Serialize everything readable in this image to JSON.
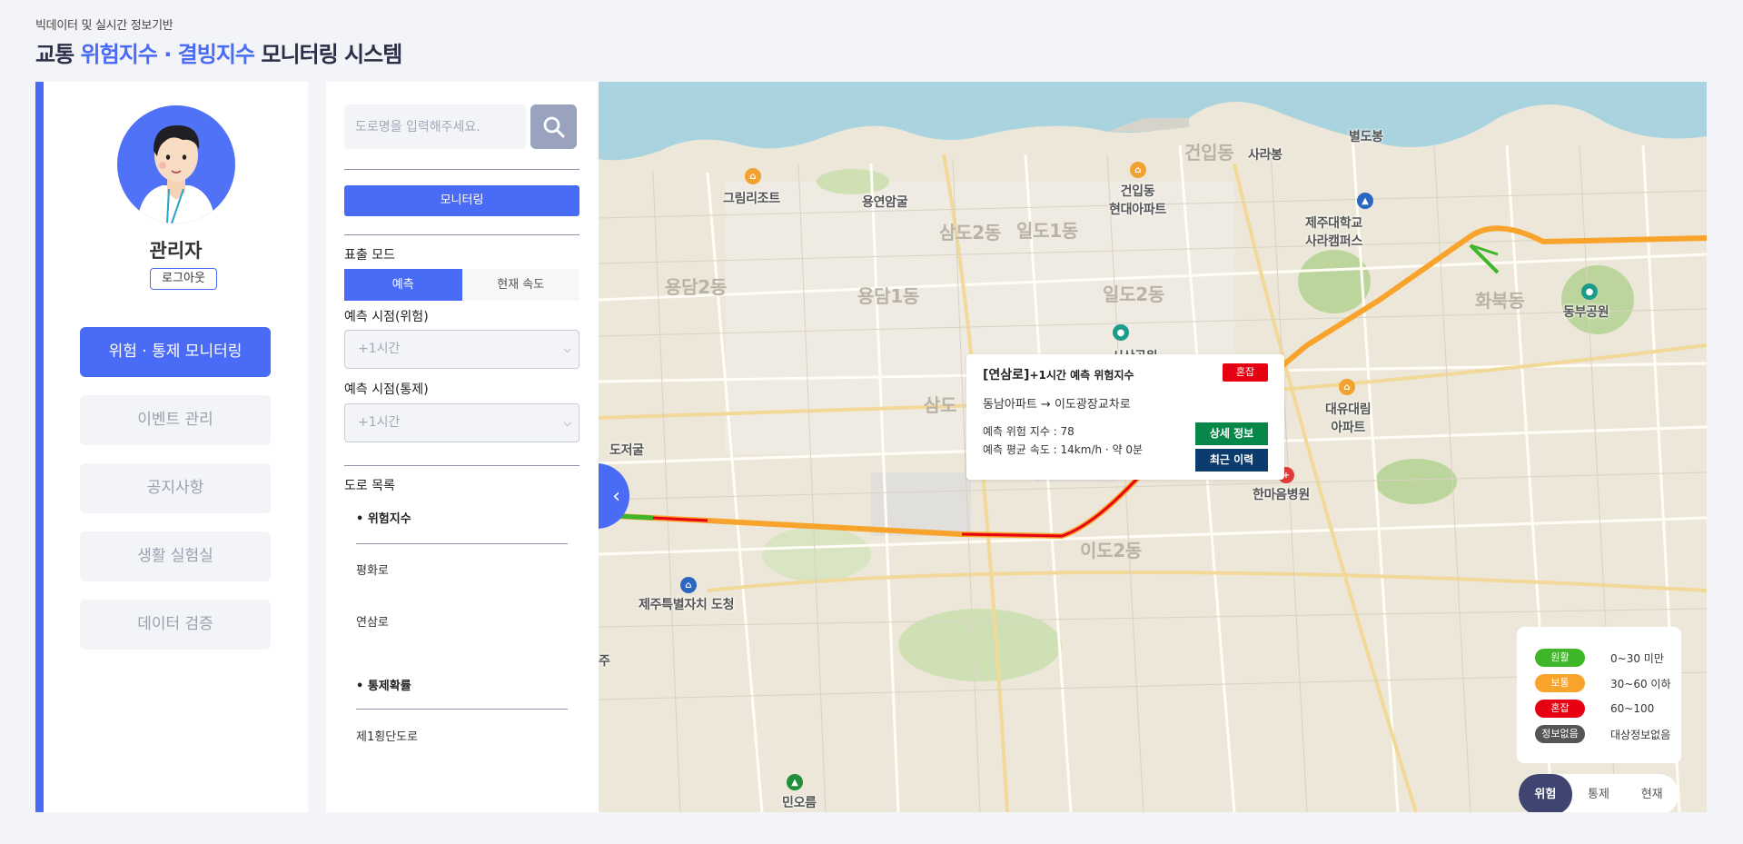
{
  "header": {
    "subtitle": "빅데이터 및 실시간 정보기반",
    "title_prefix": "교통",
    "title_highlight": "위험지수 · 결빙지수",
    "title_suffix": "모니터링 시스템"
  },
  "user": {
    "name": "관리자",
    "logout_label": "로그아웃"
  },
  "menu": {
    "items": [
      {
        "label": "위험 · 통제 모니터링",
        "active": true
      },
      {
        "label": "이벤트 관리",
        "active": false
      },
      {
        "label": "공지사항",
        "active": false
      },
      {
        "label": "생활 실험실",
        "active": false
      },
      {
        "label": "데이터 검증",
        "active": false
      }
    ]
  },
  "controls": {
    "search_placeholder": "도로명을 입력해주세요.",
    "monitor_label": "모니터링",
    "mode_label": "표출 모드",
    "mode_options": [
      "예측",
      "현재 속도"
    ],
    "forecast_risk_label": "예측 시점(위험)",
    "forecast_risk_value": "+1시간",
    "forecast_control_label": "예측 시점(통제)",
    "forecast_control_value": "+1시간",
    "road_list_label": "도로 목록",
    "risk_group_label": "• 위험지수",
    "risk_roads": [
      "평화로",
      "연삼로"
    ],
    "control_group_label": "• 통제확률",
    "control_roads": [
      "제1횡단도로"
    ]
  },
  "map": {
    "labels": {
      "grim_resort": "그림리조트",
      "yongyeon": "용연암굴",
      "geonip_apt": "건입동\n현대아파트",
      "geonip": "건입동",
      "sarabong": "사라봉",
      "byeoldobong": "별도봉",
      "jnu": "제주대학교\n사라캠퍼스",
      "hwabuk": "화북동",
      "dongbu_park": "동부공원",
      "yongdam2": "용담2동",
      "yongdam1": "용담1동",
      "samdo2": "삼도2동",
      "ildo1": "일도1동",
      "ildo2": "일도2동",
      "samdo": "삼도",
      "sisan": "시산공원",
      "daeyu_apt": "대유대림\n아파트",
      "dojeogul": "도저굴",
      "hanmaeul": "한마음병원",
      "ido2": "이도2동",
      "jeju_gov": "제주특별자치 도청",
      "minoreum": "민오름",
      "ju": "주"
    },
    "popup": {
      "road": "[연삼로]",
      "subtitle": "+1시간 예측 위험지수",
      "badge": "혼잡",
      "route": "동남아파트 → 이도광장교차로",
      "risk_line": "예측 위험 지수 : 78",
      "speed_line": "예측 평균 속도 : 14km/h · 약 0분",
      "detail_btn": "상세 정보",
      "history_btn": "최근 이력"
    },
    "legend": [
      {
        "label": "원활",
        "range": "0~30 미만",
        "color": "#3fb52a"
      },
      {
        "label": "보통",
        "range": "30~60 이하",
        "color": "#f7a32c"
      },
      {
        "label": "혼잡",
        "range": "60~100",
        "color": "#e60012"
      },
      {
        "label": "정보없음",
        "range": "대상정보없음",
        "color": "#555555"
      }
    ],
    "layer_tabs": [
      "위험",
      "통제",
      "현재"
    ],
    "active_layer": "위험"
  },
  "colors": {
    "accent": "#4a6bf5",
    "congested": "#e60012",
    "normal": "#f7a32c",
    "smooth": "#3fb52a",
    "detail_btn": "#08874b",
    "history_btn": "#0b3c6d"
  }
}
